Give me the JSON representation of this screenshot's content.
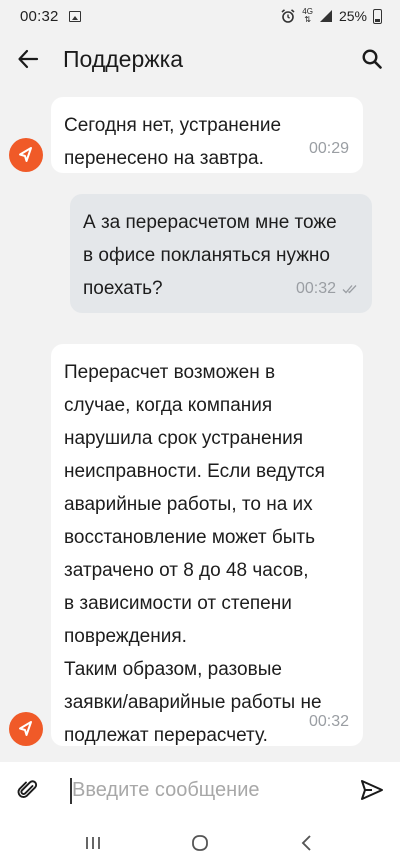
{
  "status_bar": {
    "time": "00:32",
    "network": "4G",
    "battery": "25%"
  },
  "app_bar": {
    "title": "Поддержка"
  },
  "messages": [
    {
      "direction": "incoming",
      "text": "Сегодня нет, устранение\nперенесено на завтра.",
      "time": "00:29"
    },
    {
      "direction": "outgoing",
      "text": "А за перерасчетом мне тоже\nв офисе покланяться нужно\nпоехать?",
      "time": "00:32"
    },
    {
      "direction": "incoming",
      "text": "Перерасчет возможен в\nслучае, когда компания\nнарушила срок устранения\nнеисправности. Если ведутся\nаварийные работы, то на их\nвосстановление может быть\nзатрачено от 8 до 48 часов,\nв зависимости от степени\nповреждения.\nТаким образом, разовые\nзаявки/аварийные работы не\nподлежат перерасчету.",
      "time": "00:32"
    }
  ],
  "composer": {
    "placeholder": "Введите сообщение"
  },
  "colors": {
    "accent": "#f05a28",
    "incoming_bubble": "#ffffff",
    "outgoing_bubble": "#e4e7ea",
    "background": "#f2f2f2"
  },
  "icons": {
    "back": "arrow-left-icon",
    "search": "search-icon",
    "avatar": "paper-plane-logo-icon",
    "attach": "paperclip-icon",
    "send": "send-icon",
    "read": "double-check-icon"
  }
}
